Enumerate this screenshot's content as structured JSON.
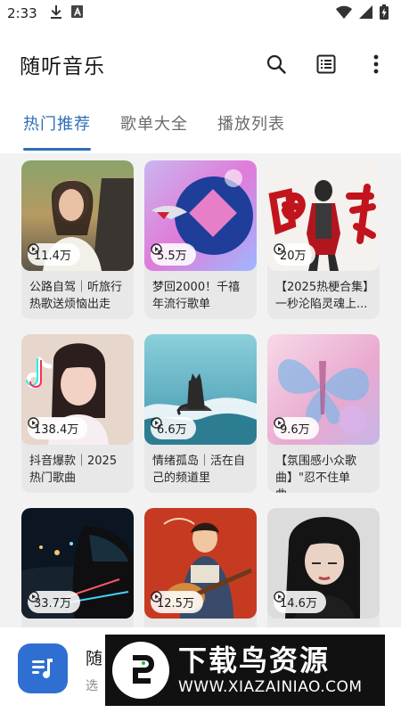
{
  "status_bar": {
    "time": "2:33",
    "left_icons": [
      "download-icon",
      "a-square-icon"
    ],
    "right_icons": [
      "wifi-icon",
      "signal-icon",
      "battery-icon"
    ]
  },
  "app_bar": {
    "title": "随听音乐",
    "actions": [
      "search-icon",
      "playlist-icon",
      "more-vert-icon"
    ]
  },
  "tabs": [
    {
      "label": "热门推荐",
      "active": true
    },
    {
      "label": "歌单大全",
      "active": false
    },
    {
      "label": "播放列表",
      "active": false
    }
  ],
  "accent_color": "#2c6fb5",
  "playlists": [
    {
      "plays": "11.4万",
      "title": "公路自驾｜听旅行热歌送烦恼出走",
      "art": "portrait-field"
    },
    {
      "plays": "5.5万",
      "title": "梦回2000！千禧年流行歌单",
      "art": "y2k-abstract"
    },
    {
      "plays": "20万",
      "title": "【2025热梗合集】一秒沦陷灵魂上...",
      "art": "ultraman-red"
    },
    {
      "plays": "138.4万",
      "title": "抖音爆款｜2025热门歌曲",
      "art": "tiktok-portrait"
    },
    {
      "plays": "6.6万",
      "title": "情绪孤岛｜活在自己的频道里",
      "art": "cat-on-rock"
    },
    {
      "plays": "9.6万",
      "title": "【氛围感小众歌曲】\"忍不住单曲...",
      "art": "butterfly-pink"
    },
    {
      "plays": "33.7万",
      "title": "",
      "art": "night-car"
    },
    {
      "plays": "12.5万",
      "title": "",
      "art": "guitar-illustration"
    },
    {
      "plays": "14.6万",
      "title": "",
      "art": "retro-portrait"
    }
  ],
  "now_playing": {
    "title": "随",
    "subtitle": "选",
    "icon": "music-note-icon"
  },
  "watermark": {
    "main": "下载鸟资源",
    "url": "WWW.XIAZAINIAO.COM"
  }
}
